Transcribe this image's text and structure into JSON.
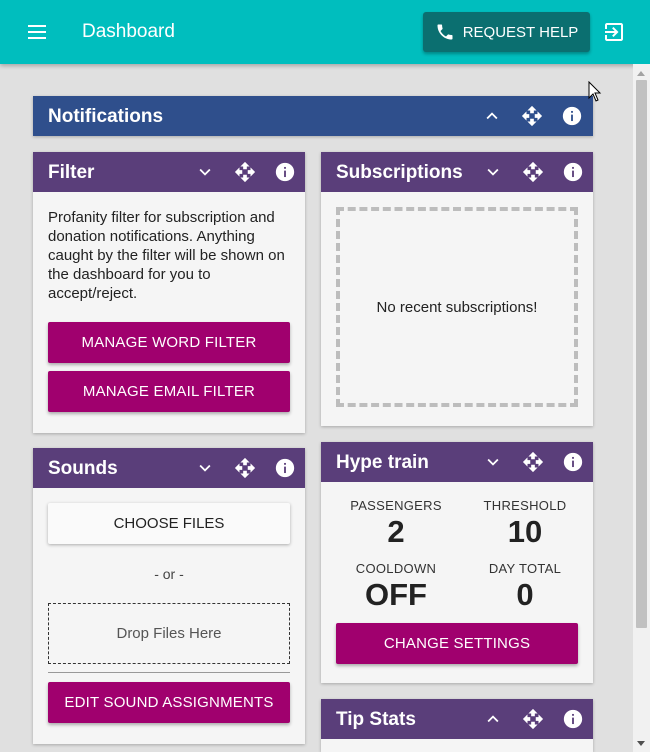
{
  "app": {
    "title": "Dashboard"
  },
  "topbar": {
    "request_help": "REQUEST HELP"
  },
  "panels": {
    "notifications": {
      "title": "Notifications"
    },
    "filter": {
      "title": "Filter",
      "description": "Profanity filter for subscription and donation notifications. Anything caught by the filter will be shown on the dashboard for you to accept/reject.",
      "manage_word": "MANAGE WORD FILTER",
      "manage_email": "MANAGE EMAIL FILTER"
    },
    "subscriptions": {
      "title": "Subscriptions",
      "empty": "No recent subscriptions!"
    },
    "sounds": {
      "title": "Sounds",
      "choose_files": "CHOOSE FILES",
      "or": "- or -",
      "drop": "Drop Files Here",
      "edit_assignments": "EDIT SOUND ASSIGNMENTS"
    },
    "hype_train": {
      "title": "Hype train",
      "stats": [
        {
          "label": "PASSENGERS",
          "value": "2"
        },
        {
          "label": "THRESHOLD",
          "value": "10"
        },
        {
          "label": "COOLDOWN",
          "value": "OFF"
        },
        {
          "label": "DAY TOTAL",
          "value": "0"
        }
      ],
      "change_settings": "CHANGE SETTINGS"
    },
    "tip_stats": {
      "title": "Tip Stats"
    }
  },
  "icons": [
    "menu-icon",
    "phone-icon",
    "logout-icon",
    "chevron-up-icon",
    "chevron-down-icon",
    "move-icon",
    "info-icon"
  ],
  "colors": {
    "topbar": "#00bebe",
    "request_help": "#0b6f70",
    "panel_header": "#5a3e7a",
    "notifications_header": "#2f4f8c",
    "button": "#a0006e"
  }
}
